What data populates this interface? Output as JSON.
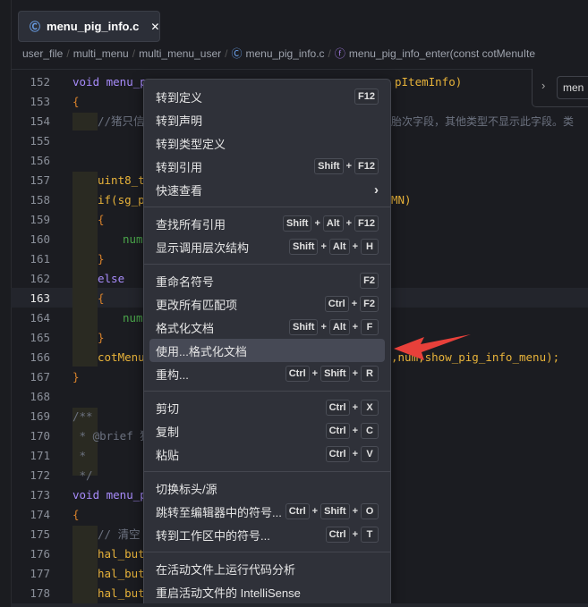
{
  "tab": {
    "title": "menu_pig_info.c",
    "icon": "c-file-icon",
    "close": "✕"
  },
  "breadcrumb": [
    "user_file",
    "multi_menu",
    "multi_menu_user",
    "menu_pig_info.c",
    "menu_pig_info_enter(const cotMenuIte"
  ],
  "find_panel": {
    "value": "men"
  },
  "lines": [
    {
      "n": "152",
      "left": "void menu_p",
      "right": "pItemInfo)"
    },
    {
      "n": "153",
      "left": "{",
      "right": ""
    },
    {
      "n": "154",
      "left": "//猪只信",
      "right": "胎次字段，其他类型不显示此字段。类"
    },
    {
      "n": "155",
      "left": "",
      "right": ""
    },
    {
      "n": "156",
      "left": "",
      "right": ""
    },
    {
      "n": "157",
      "left": "uint8_t",
      "right": ""
    },
    {
      "n": "158",
      "left": "if(sg_p",
      "right": "MN)"
    },
    {
      "n": "159",
      "left": "{",
      "right": ""
    },
    {
      "n": "160",
      "left": "num",
      "right": ""
    },
    {
      "n": "161",
      "left": "}",
      "right": ""
    },
    {
      "n": "162",
      "left": "else",
      "right": ""
    },
    {
      "n": "163",
      "left": "{",
      "right": ""
    },
    {
      "n": "164",
      "left": "num",
      "right": ""
    },
    {
      "n": "165",
      "left": "}",
      "right": ""
    },
    {
      "n": "166",
      "left": "cotMenu",
      "right": ",num,show_pig_info_menu);"
    },
    {
      "n": "167",
      "left": "}",
      "right": ""
    },
    {
      "n": "168",
      "left": "",
      "right": ""
    },
    {
      "n": "169",
      "left": "/**",
      "right": ""
    },
    {
      "n": "170",
      "left": " * @brief 猪",
      "right": ""
    },
    {
      "n": "171",
      "left": " *",
      "right": ""
    },
    {
      "n": "172",
      "left": " */",
      "right": ""
    },
    {
      "n": "173",
      "left": "void menu_p",
      "right": ""
    },
    {
      "n": "174",
      "left": "{",
      "right": ""
    },
    {
      "n": "175",
      "left": "// 清空",
      "right": ""
    },
    {
      "n": "176",
      "left": "hal_but",
      "right": ""
    },
    {
      "n": "177",
      "left": "hal_but",
      "right": ""
    },
    {
      "n": "178",
      "left": "hal_but",
      "right": ""
    }
  ],
  "current_line": "163",
  "context_menu": {
    "items": [
      {
        "label": "转到定义",
        "keys": [
          "F12"
        ]
      },
      {
        "label": "转到声明",
        "keys": []
      },
      {
        "label": "转到类型定义",
        "keys": []
      },
      {
        "label": "转到引用",
        "keys": [
          "Shift",
          "F12"
        ]
      },
      {
        "label": "快速查看",
        "keys": [],
        "submenu": "›"
      },
      {
        "sep": true
      },
      {
        "label": "查找所有引用",
        "keys": [
          "Shift",
          "Alt",
          "F12"
        ]
      },
      {
        "label": "显示调用层次结构",
        "keys": [
          "Shift",
          "Alt",
          "H"
        ]
      },
      {
        "sep": true
      },
      {
        "label": "重命名符号",
        "keys": [
          "F2"
        ]
      },
      {
        "label": "更改所有匹配项",
        "keys": [
          "Ctrl",
          "F2"
        ]
      },
      {
        "label": "格式化文档",
        "keys": [
          "Shift",
          "Alt",
          "F"
        ]
      },
      {
        "label": "使用...格式化文档",
        "keys": [],
        "highlighted": true
      },
      {
        "label": "重构...",
        "keys": [
          "Ctrl",
          "Shift",
          "R"
        ]
      },
      {
        "sep": true
      },
      {
        "label": "剪切",
        "keys": [
          "Ctrl",
          "X"
        ]
      },
      {
        "label": "复制",
        "keys": [
          "Ctrl",
          "C"
        ]
      },
      {
        "label": "粘贴",
        "keys": [
          "Ctrl",
          "V"
        ]
      },
      {
        "sep": true
      },
      {
        "label": "切换标头/源",
        "keys": []
      },
      {
        "label": "跳转至编辑器中的符号...",
        "keys": [
          "Ctrl",
          "Shift",
          "O"
        ]
      },
      {
        "label": "转到工作区中的符号...",
        "keys": [
          "Ctrl",
          "T"
        ]
      },
      {
        "sep": true
      },
      {
        "label": "在活动文件上运行代码分析",
        "keys": []
      },
      {
        "label": "重启活动文件的 IntelliSense",
        "keys": []
      }
    ]
  },
  "annotation": {
    "color": "#e8403a"
  }
}
